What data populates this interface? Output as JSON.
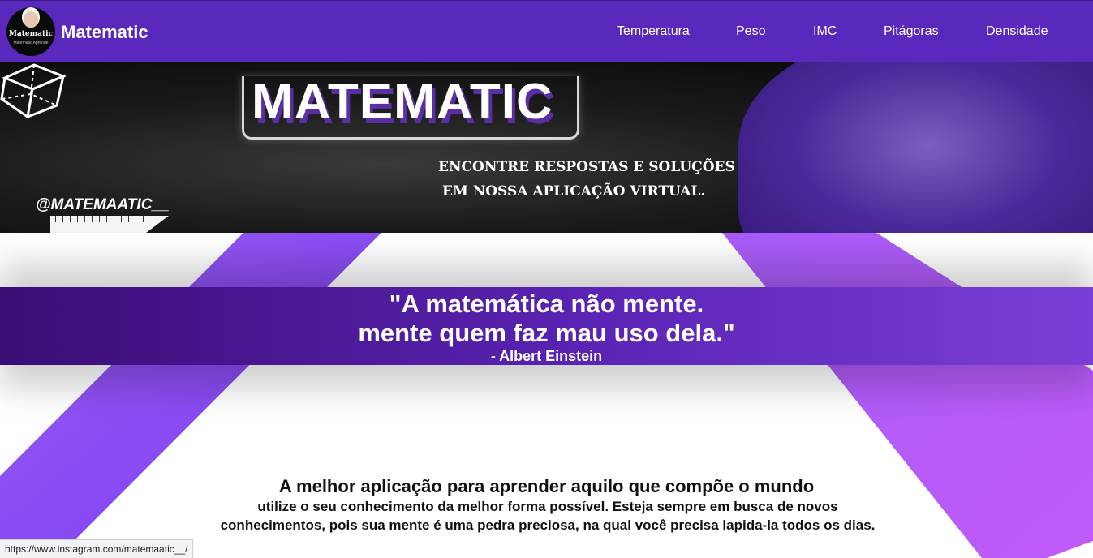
{
  "navbar": {
    "logo_text": "Matematic",
    "logo_subtext": "Matematic Aprende",
    "brand": "Matematic",
    "links": [
      {
        "label": "Temperatura"
      },
      {
        "label": "Peso"
      },
      {
        "label": "IMC"
      },
      {
        "label": "Pitágoras"
      },
      {
        "label": "Densidade"
      }
    ]
  },
  "banner": {
    "title": "MATEMATIC",
    "subtitle_line1": "ENCONTRE RESPOSTAS E SOLUÇÕES",
    "subtitle_line2": "EM NOSSA APLICAÇÃO VIRTUAL.",
    "handle": "@MATEMAATIC__"
  },
  "quote": {
    "line1": "\"A matemática não mente.",
    "line2": "mente quem faz mau uso dela.\"",
    "author": "- Albert Einstein"
  },
  "main": {
    "tagline": "A melhor aplicação para aprender aquilo que compõe o mundo",
    "description": "utilize o seu conhecimento da melhor forma possível. Esteja sempre em busca de novos conhecimentos, pois sua mente é uma pedra preciosa, na qual você precisa lapida-la todos os dias."
  },
  "status_bar": {
    "url": "https://www.instagram.com/matemaatic__/"
  },
  "colors": {
    "navbar": "#5b28bd",
    "quote_band_start": "#3a0d75",
    "quote_band_end": "#7a3fd8",
    "stripe": "#8a4cf0"
  }
}
